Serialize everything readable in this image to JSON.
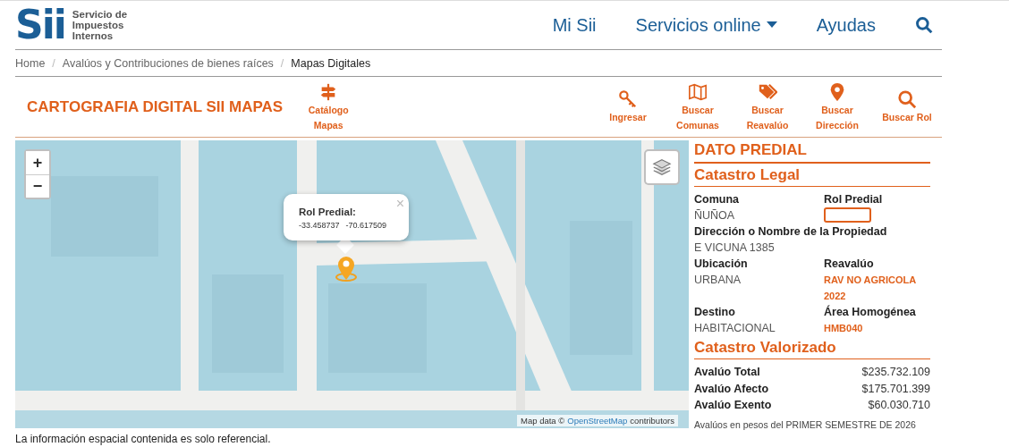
{
  "header": {
    "logo_mark": "Sii",
    "logo_text": [
      "Servicio de",
      "Impuestos",
      "Internos"
    ],
    "nav": [
      {
        "label": "Mi Sii",
        "dropdown": false
      },
      {
        "label": "Servicios online",
        "dropdown": true
      },
      {
        "label": "Ayudas",
        "dropdown": false
      }
    ]
  },
  "breadcrumb": [
    {
      "label": "Home",
      "current": false
    },
    {
      "separator": "/",
      "label": "Avalúos y Contribuciones de bienes raíces",
      "current": false
    },
    {
      "separator": "/",
      "label": "Mapas Digitales",
      "current": true
    }
  ],
  "toolbar": {
    "title": "CARTOGRAFIA DIGITAL SII MAPAS",
    "catalog": {
      "label": [
        "Catálogo",
        "Mapas"
      ]
    },
    "tools": [
      {
        "label": [
          "Ingresar"
        ]
      },
      {
        "label": [
          "Buscar",
          "Comunas"
        ]
      },
      {
        "label": [
          "Buscar",
          "Reavalúo"
        ]
      },
      {
        "label": [
          "Buscar",
          "Dirección"
        ]
      },
      {
        "label": [
          "Buscar Rol"
        ]
      }
    ]
  },
  "map": {
    "zoom_in": "+",
    "zoom_out": "−",
    "popup": {
      "title": "Rol Predial:",
      "lat": "-33.458737",
      "lng": "-70.617509",
      "close": "×"
    },
    "attribution": {
      "prefix": "Map data ©",
      "link": "OpenStreetMap",
      "suffix": "contributors"
    }
  },
  "panel": {
    "title": "DATO PREDIAL",
    "legal_title": "Catastro Legal",
    "fields": [
      {
        "label": "Comuna",
        "value": "ÑUÑOA",
        "kind": "plain"
      },
      {
        "label": "Rol Predial",
        "kind": "redacted"
      },
      {
        "label": "Dirección o Nombre de la Propiedad",
        "value": "E VICUNA 1385",
        "kind": "wide"
      },
      {
        "label": "Ubicación",
        "value": "URBANA",
        "kind": "plain"
      },
      {
        "label": "Reavalúo",
        "value": "RAV NO AGRICOLA 2022",
        "kind": "accent"
      },
      {
        "label": "Destino",
        "value": "HABITACIONAL",
        "kind": "plain"
      },
      {
        "label": "Área Homogénea",
        "value": "HMB040",
        "kind": "accent"
      }
    ],
    "valued_title": "Catastro Valorizado",
    "values": [
      {
        "label": "Avalúo Total",
        "value": "$235.732.109"
      },
      {
        "label": "Avalúo Afecto",
        "value": "$175.701.399"
      },
      {
        "label": "Avalúo Exento",
        "value": "$60.030.710"
      }
    ],
    "note": "Avalúos en pesos del PRIMER SEMESTRE DE 2026"
  },
  "footer_note": "La información espacial contenida es solo referencial."
}
